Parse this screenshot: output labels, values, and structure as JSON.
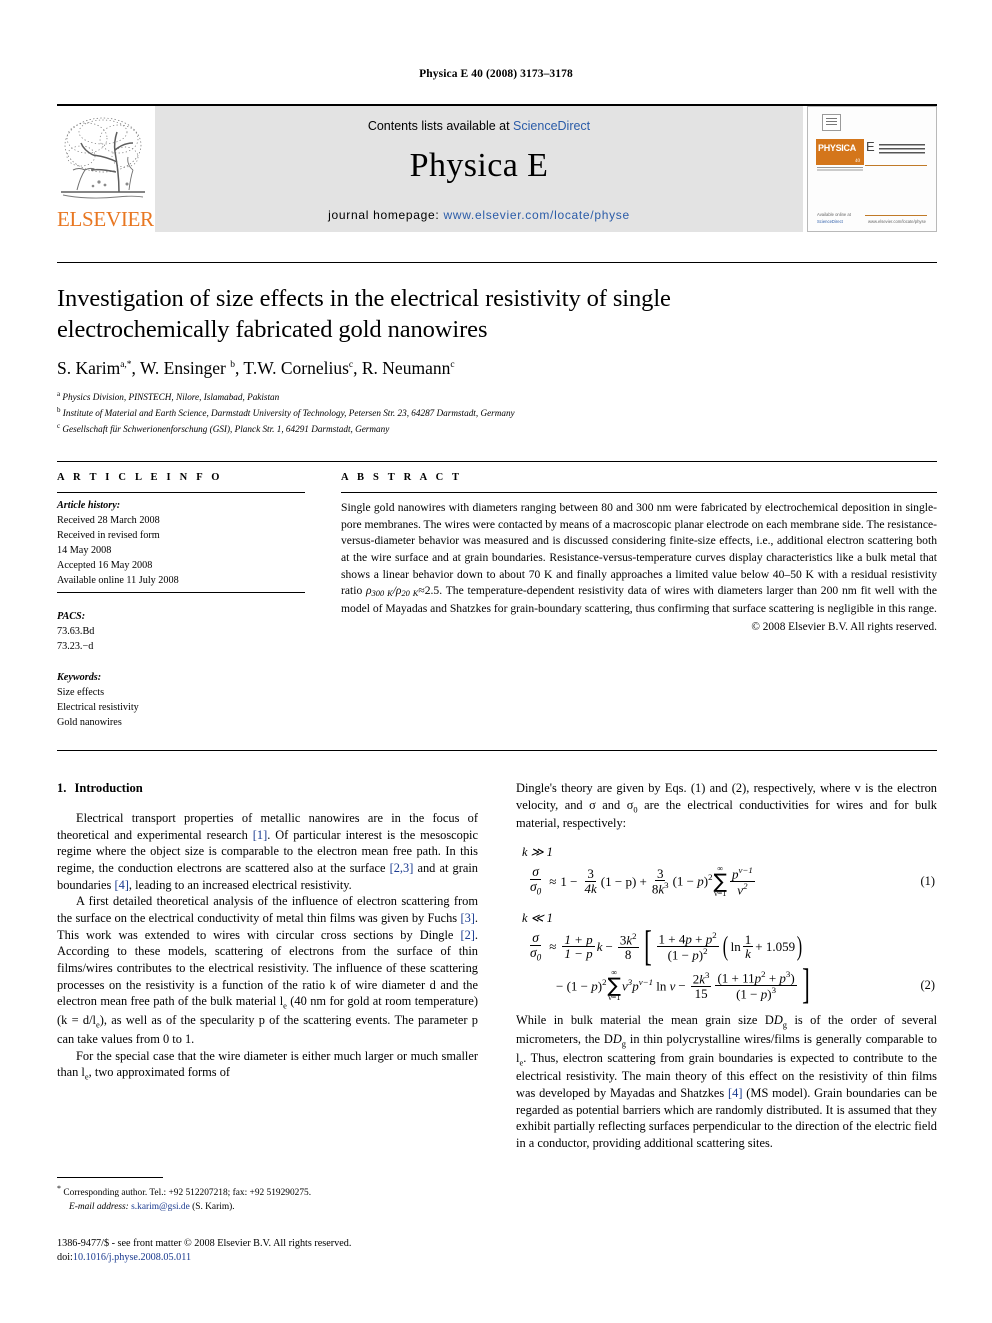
{
  "running_head": "Physica E 40 (2008) 3173–3178",
  "masthead": {
    "publisher_name": "ELSEVIER",
    "contents_prefix": "Contents lists available at ",
    "contents_link": "ScienceDirect",
    "journal_title": "Physica E",
    "homepage_label": "journal homepage: ",
    "homepage_url": "www.elsevier.com/locate/physe",
    "cover": {
      "brand": "PHYSICA",
      "letter": "E",
      "subtitle": "LOW-DIMENSIONAL SYSTEMS & NANOSTRUCTURES",
      "footer_left": "Available online at",
      "footer_sd": "ScienceDirect",
      "footer_right": "www.elsevier.com/locate/physe"
    }
  },
  "article": {
    "title": "Investigation of size effects in the electrical resistivity of single electrochemically fabricated gold nanowires",
    "authors": [
      {
        "name": "S. Karim",
        "marks": "a,*"
      },
      {
        "name": "W. Ensinger",
        "marks": "b"
      },
      {
        "name": "T.W. Cornelius",
        "marks": "c"
      },
      {
        "name": "R. Neumann",
        "marks": "c"
      }
    ],
    "affiliations": [
      {
        "mark": "a",
        "text": "Physics Division, PINSTECH, Nilore, Islamabad, Pakistan"
      },
      {
        "mark": "b",
        "text": "Institute of Material and Earth Science, Darmstadt University of Technology, Petersen Str. 23, 64287 Darmstadt, Germany"
      },
      {
        "mark": "c",
        "text": "Gesellschaft für Schwerionenforschung (GSI), Planck Str. 1, 64291 Darmstadt, Germany"
      }
    ]
  },
  "info": {
    "heading": "A R T I C L E   I N F O",
    "history_label": "Article history:",
    "history": [
      "Received 28 March 2008",
      "Received in revised form",
      "14 May 2008",
      "Accepted 16 May 2008",
      "Available online 11 July 2008"
    ],
    "pacs_label": "PACS:",
    "pacs": [
      "73.63.Bd",
      "73.23.−d"
    ],
    "keywords_label": "Keywords:",
    "keywords": [
      "Size effects",
      "Electrical resistivity",
      "Gold nanowires"
    ]
  },
  "abstract": {
    "heading": "A B S T R A C T",
    "text_1": "Single gold nanowires with diameters ranging between 80 and 300 nm were fabricated by electrochemical deposition in single-pore membranes. The wires were contacted by means of a macroscopic planar electrode on each membrane side. The resistance-versus-diameter behavior was measured and is discussed considering finite-size effects, i.e., additional electron scattering both at the wire surface and at grain boundaries. Resistance-versus-temperature curves display characteristics like a bulk metal that shows a linear behavior down to about 70 K and finally approaches a limited value below 40–50 K with a residual resistivity ratio ",
    "rho_ratio": {
      "num_sub": "300 K",
      "den_sub": "20 K",
      "approx": "≈2.5."
    },
    "text_2": " The temperature-dependent resistivity data of wires with diameters larger than 200 nm fit well with the model of Mayadas and Shatzkes for grain-boundary scattering, thus confirming that surface scattering is negligible in this range.",
    "copyright": "© 2008 Elsevier B.V. All rights reserved."
  },
  "body": {
    "section_number": "1.",
    "section_title": "Introduction",
    "left_p1_a": "Electrical transport properties of metallic nanowires are in the focus of theoretical and experimental research ",
    "left_p1_cite1": "[1]",
    "left_p1_b": ". Of particular interest is the mesoscopic regime where the object size is comparable to the electron mean free path. In this regime, the conduction electrons are scattered also at the surface ",
    "left_p1_cite2": "[2,3]",
    "left_p1_c": " and at grain boundaries ",
    "left_p1_cite3": "[4]",
    "left_p1_d": ", leading to an increased electrical resistivity.",
    "left_p2_a": "A first detailed theoretical analysis of the influence of electron scattering from the surface on the electrical conductivity of metal thin films was given by Fuchs ",
    "left_p2_cite1": "[3]",
    "left_p2_b": ". This work was extended to wires with circular cross sections by Dingle ",
    "left_p2_cite2": "[2]",
    "left_p2_c": ". According to these models, scattering of electrons from the surface of thin films/wires contributes to the electrical resistivity. The influence of these scattering processes on the resistivity is a function of the ratio k of wire diameter d and the electron mean free path of the bulk material l",
    "left_p2_d": " (40 nm for gold at room temperature) (k = d/l",
    "left_p2_e": "), as well as of the specularity p of the scattering events. The parameter p can take values from 0 to 1.",
    "left_p3_a": "For the special case that the wire diameter is either much larger or much smaller than l",
    "left_p3_b": ", two approximated forms of",
    "right_p1_a": "Dingle's theory are given by Eqs. (1) and (2), respectively, where v is the electron velocity, and σ and σ",
    "right_p1_b": " are the electrical conductivities for wires and for bulk material, respectively:",
    "eq1_cond": "k ≫ 1",
    "eq1_number": "(1)",
    "eq2_cond": "k ≪ 1",
    "eq2_number": "(2)",
    "right_p2_a": "While in bulk material the mean grain size D",
    "right_p2_b": " is of the order of several micrometers, the D",
    "right_p2_c": " in thin polycrystalline wires/films is generally comparable to l",
    "right_p2_d": ". Thus, electron scattering from grain boundaries is expected to contribute to the electrical resistivity. The main theory of this effect on the resistivity of thin films was developed by Mayadas and Shatzkes ",
    "right_p2_cite": "[4]",
    "right_p2_e": " (MS model). Grain boundaries can be regarded as potential barriers which are randomly distributed. It is assumed that they exhibit partially reflecting surfaces perpendicular to the direction of the electric field in a conductor, providing additional scattering sites."
  },
  "equations": {
    "eq1": {
      "lhs_num": "σ",
      "lhs_den": "σ0",
      "approx": "≈",
      "term1": "1 −",
      "f1_n": "3",
      "f1_d": "4k",
      "f1_tail": "(1 − p) +",
      "f2_n": "3",
      "f2_d": "8k3",
      "f2_tail": "(1 − p)2",
      "sum_top": "∞",
      "sum_bot": "ν=1",
      "f3_n": "pν−1",
      "f3_d": "ν2"
    },
    "eq2": {
      "lhs_num": "σ",
      "lhs_den": "σ0",
      "approx": "≈",
      "f1_n": "1 + p",
      "f1_d": "1 − p",
      "f1_tail": "k −",
      "f2_n": "3k2",
      "f2_d": "8",
      "f3_n": "1 + 4p + p2",
      "f3_d": "(1 − p)2",
      "ln_pre": "ln",
      "ln_n": "1",
      "ln_d": "k",
      "ln_tail": "+ 1.059",
      "l2_pre": "− (1 − p)2",
      "sum_top": "∞",
      "sum_bot": "ν=1",
      "l2_mid": "ν3pν−1 ln ν −",
      "f4_n": "2k3",
      "f4_d": "15",
      "f5_n": "(1 + 11p2 + p3)",
      "f5_d": "(1 − p)3"
    }
  },
  "footnote": {
    "star": "*",
    "text": " Corresponding author. Tel.: +92 512207218; fax: +92 519290275.",
    "email_label": "E-mail address:",
    "email": "s.karim@gsi.de",
    "email_owner": "(S. Karim)."
  },
  "copyright_line": {
    "issn_text": "1386-9477/$ - see front matter © 2008 Elsevier B.V. All rights reserved.",
    "doi_label": "doi:",
    "doi": "10.1016/j.physe.2008.05.011"
  }
}
